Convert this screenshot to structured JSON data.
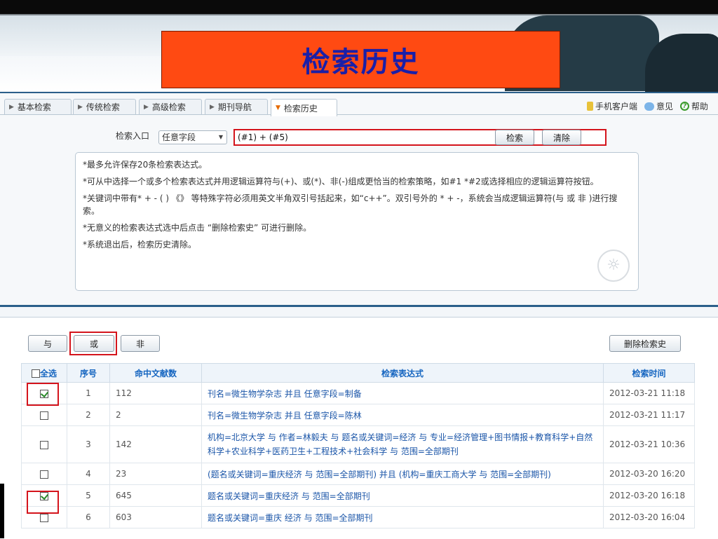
{
  "slide_title": "检索历史",
  "tabs": [
    {
      "label": "基本检索",
      "active": false
    },
    {
      "label": "传统检索",
      "active": false
    },
    {
      "label": "高级检索",
      "active": false
    },
    {
      "label": "期刊导航",
      "active": false
    },
    {
      "label": "检索历史",
      "active": true
    }
  ],
  "top_links": {
    "mobile": "手机客户端",
    "opinion": "意见",
    "help": "帮助"
  },
  "search": {
    "label": "检索入口",
    "field_selected": "任意字段",
    "query": "(#1) + (#5)",
    "search_button": "检索",
    "clear_button": "清除"
  },
  "tips": [
    "*最多允许保存20条检索表达式。",
    "*可从中选择一个或多个检索表达式并用逻辑运算符与(+)、或(*)、非(-)组成更恰当的检索策略，如#1 *#2或选择相应的逻辑运算符按钮。",
    "*关键词中带有* + - ( ) 《》 等特殊字符必须用英文半角双引号括起来，如“c++”。双引号外的 * + -，系统会当成逻辑运算符(与 或 非 )进行搜索。",
    "*无意义的检索表达式选中后点击 “删除检索史” 可进行删除。",
    "*系统退出后，检索历史清除。"
  ],
  "ops": {
    "and": "与",
    "or": "或",
    "not": "非",
    "delete": "删除检索史"
  },
  "table": {
    "headers": [
      "全选",
      "序号",
      "命中文献数",
      "检索表达式",
      "检索时间"
    ],
    "rows": [
      {
        "checked": true,
        "no": "1",
        "hits": "112",
        "expr": "刊名=微生物学杂志 并且 任意字段=制备",
        "time": "2012-03-21 11:18"
      },
      {
        "checked": false,
        "no": "2",
        "hits": "2",
        "expr": "刊名=微生物学杂志 并且 任意字段=陈林",
        "time": "2012-03-21 11:17"
      },
      {
        "checked": false,
        "no": "3",
        "hits": "142",
        "expr": "机构=北京大学 与 作者=林毅夫 与 题名或关键词=经济 与 专业=经济管理+图书情报+教育科学+自然科学+农业科学+医药卫生+工程技术+社会科学 与 范围=全部期刊",
        "time": "2012-03-21 10:36"
      },
      {
        "checked": false,
        "no": "4",
        "hits": "23",
        "expr": "(题名或关键词=重庆经济 与 范围=全部期刊) 并且 (机构=重庆工商大学 与 范围=全部期刊)",
        "time": "2012-03-20 16:20"
      },
      {
        "checked": true,
        "no": "5",
        "hits": "645",
        "expr": "题名或关键词=重庆经济 与 范围=全部期刊",
        "time": "2012-03-20 16:18"
      },
      {
        "checked": false,
        "no": "6",
        "hits": "603",
        "expr": "题名或关键词=重庆 经济 与 范围=全部期刊",
        "time": "2012-03-20 16:04"
      }
    ]
  }
}
